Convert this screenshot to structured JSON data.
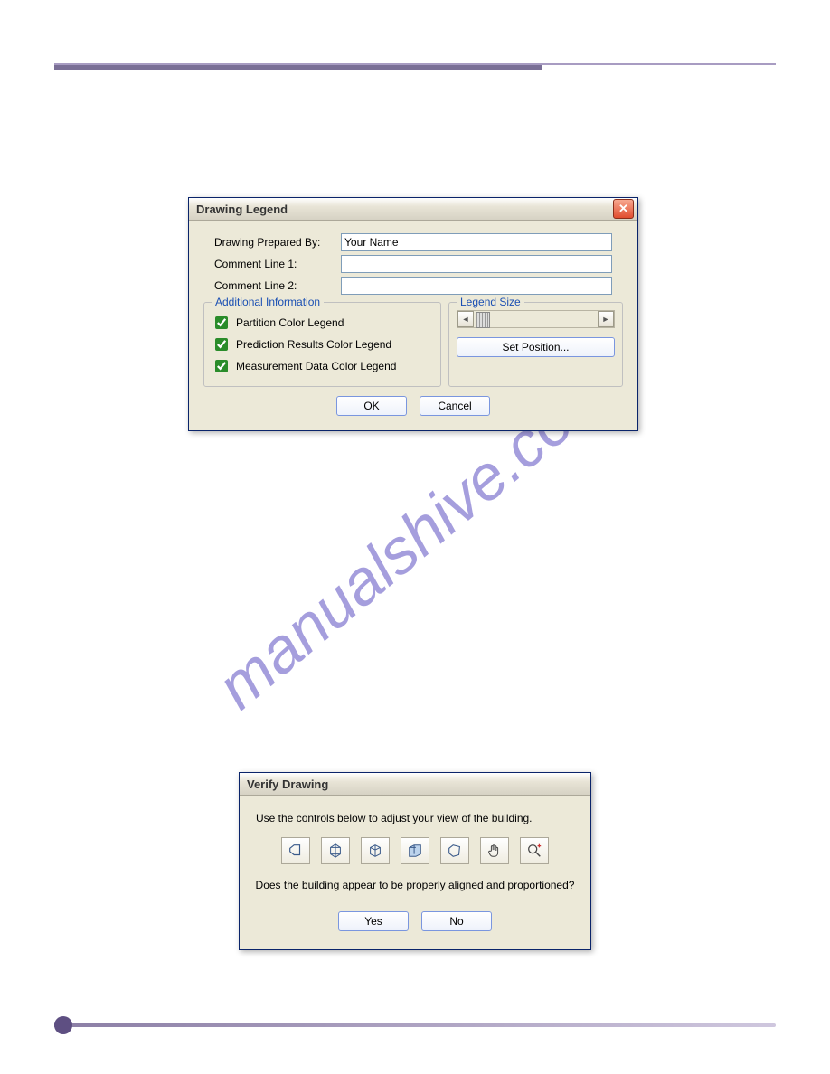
{
  "watermark": "manualshive.com",
  "dialog1": {
    "title": "Drawing Legend",
    "fields": {
      "prepared_label": "Drawing Prepared By:",
      "prepared_value": "Your Name",
      "c1_label": "Comment Line 1:",
      "c1_value": "",
      "c2_label": "Comment Line 2:",
      "c2_value": ""
    },
    "additional": {
      "legend": "Additional Information",
      "chk1": "Partition Color Legend",
      "chk2": "Prediction Results Color Legend",
      "chk3": "Measurement Data Color Legend"
    },
    "size": {
      "legend": "Legend Size",
      "setpos": "Set Position..."
    },
    "ok": "OK",
    "cancel": "Cancel"
  },
  "dialog2": {
    "title": "Verify Drawing",
    "msg1": "Use the controls below to adjust your view of the building.",
    "msg2": "Does the building appear to be properly aligned and proportioned?",
    "yes": "Yes",
    "no": "No",
    "tool_names": [
      "view-front",
      "view-wire",
      "view-iso",
      "view-top",
      "view-persp",
      "pan-hand",
      "zoom-plus"
    ]
  }
}
